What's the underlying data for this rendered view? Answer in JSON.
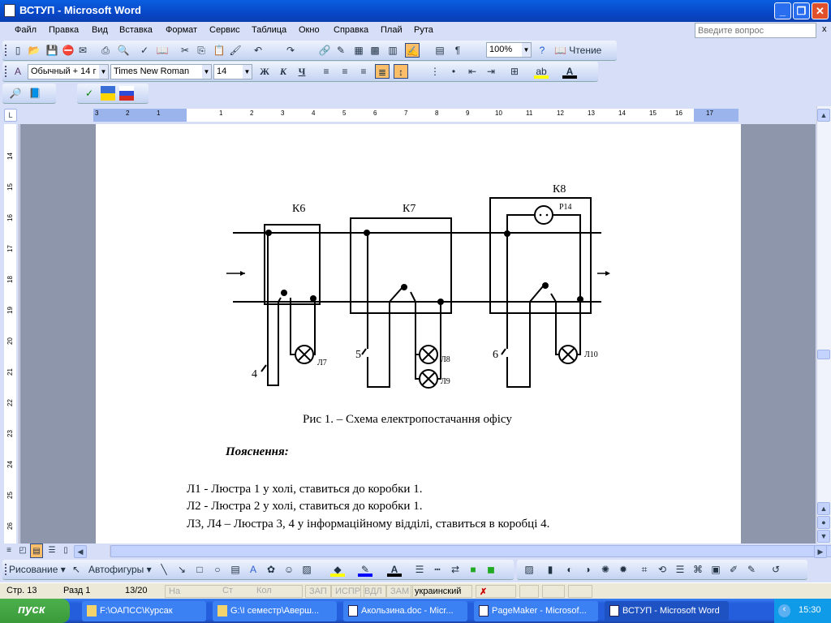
{
  "window": {
    "title": "ВСТУП - Microsoft Word",
    "minimize": "_",
    "restore": "❐",
    "close": "✕"
  },
  "menu": {
    "items": [
      "Файл",
      "Правка",
      "Вид",
      "Вставка",
      "Формат",
      "Сервис",
      "Таблица",
      "Окно",
      "Справка",
      "Плай",
      "Рута"
    ],
    "help_placeholder": "Введите вопрос",
    "close_doc": "x"
  },
  "standard_toolbar": {
    "icons": [
      "new-document-icon",
      "open-folder-icon",
      "save-icon",
      "permission-icon",
      "email-icon",
      "print-icon",
      "print-preview-icon",
      "spelling-icon",
      "research-icon",
      "cut-icon",
      "copy-icon",
      "paste-icon",
      "format-painter-icon",
      "undo-icon",
      "redo-icon",
      "hyperlink-icon",
      "tables-borders-icon",
      "insert-table-icon",
      "insert-excel-icon",
      "columns-icon",
      "drawing-icon",
      "document-map-icon",
      "show-formatting-icon"
    ],
    "zoom": "100%",
    "reading_label": "Чтение"
  },
  "formatting_toolbar": {
    "style": "Обычный + 14 г",
    "font": "Times New Roman",
    "size": "14",
    "bold": "Ж",
    "italic": "К",
    "underline": "Ч",
    "highlight_color": "#ffff00",
    "font_color": "#000000"
  },
  "ruler": {
    "numbers": [
      "3",
      "2",
      "1",
      "1",
      "2",
      "3",
      "4",
      "5",
      "6",
      "7",
      "8",
      "9",
      "10",
      "11",
      "12",
      "13",
      "14",
      "15",
      "16",
      "17"
    ],
    "vertical_numbers": [
      "14",
      "15",
      "16",
      "17",
      "18",
      "19",
      "20",
      "21",
      "22",
      "23",
      "24",
      "25",
      "26"
    ]
  },
  "diagram": {
    "boxes": [
      "К6",
      "К7",
      "К8"
    ],
    "socket": "Р14",
    "switches": [
      "4",
      "5",
      "6"
    ],
    "lamps": [
      "Л7",
      "Л8",
      "Л9",
      "Л10"
    ]
  },
  "document": {
    "caption": "Рис 1. – Схема електропостачання офісу",
    "heading": "Пояснення:",
    "lines": [
      "Л1 - Люстра 1 у холі, ставиться до коробки 1.",
      "Л2 - Люстра 2 у холі, ставиться до коробки 1.",
      "Л3, Л4 – Люстра 3, 4 у інформаційному відділі, ставиться в коробці 4."
    ]
  },
  "drawing_toolbar": {
    "draw_label": "Рисование",
    "autoshapes_label": "Автофигуры",
    "fill_color": "#ffff00",
    "line_color": "#0000ff",
    "font_color": "#000000"
  },
  "status": {
    "page": "Стр. 13",
    "section": "Разд 1",
    "pages": "13/20",
    "at": "На",
    "line": "Ст",
    "col": "Кол",
    "rec": "ЗАП",
    "trk": "ИСПР",
    "ext": "ВДЛ",
    "ovr": "ЗАМ",
    "language": "украинский"
  },
  "taskbar": {
    "start": "пуск",
    "tasks": [
      "F:\\ОАПСС\\Курсак",
      "G:\\I семестр\\Аверш...",
      "Акользина.doc - Micr...",
      "PageMaker - Microsof...",
      "ВСТУП - Microsoft Word"
    ],
    "clock": "15:30"
  }
}
